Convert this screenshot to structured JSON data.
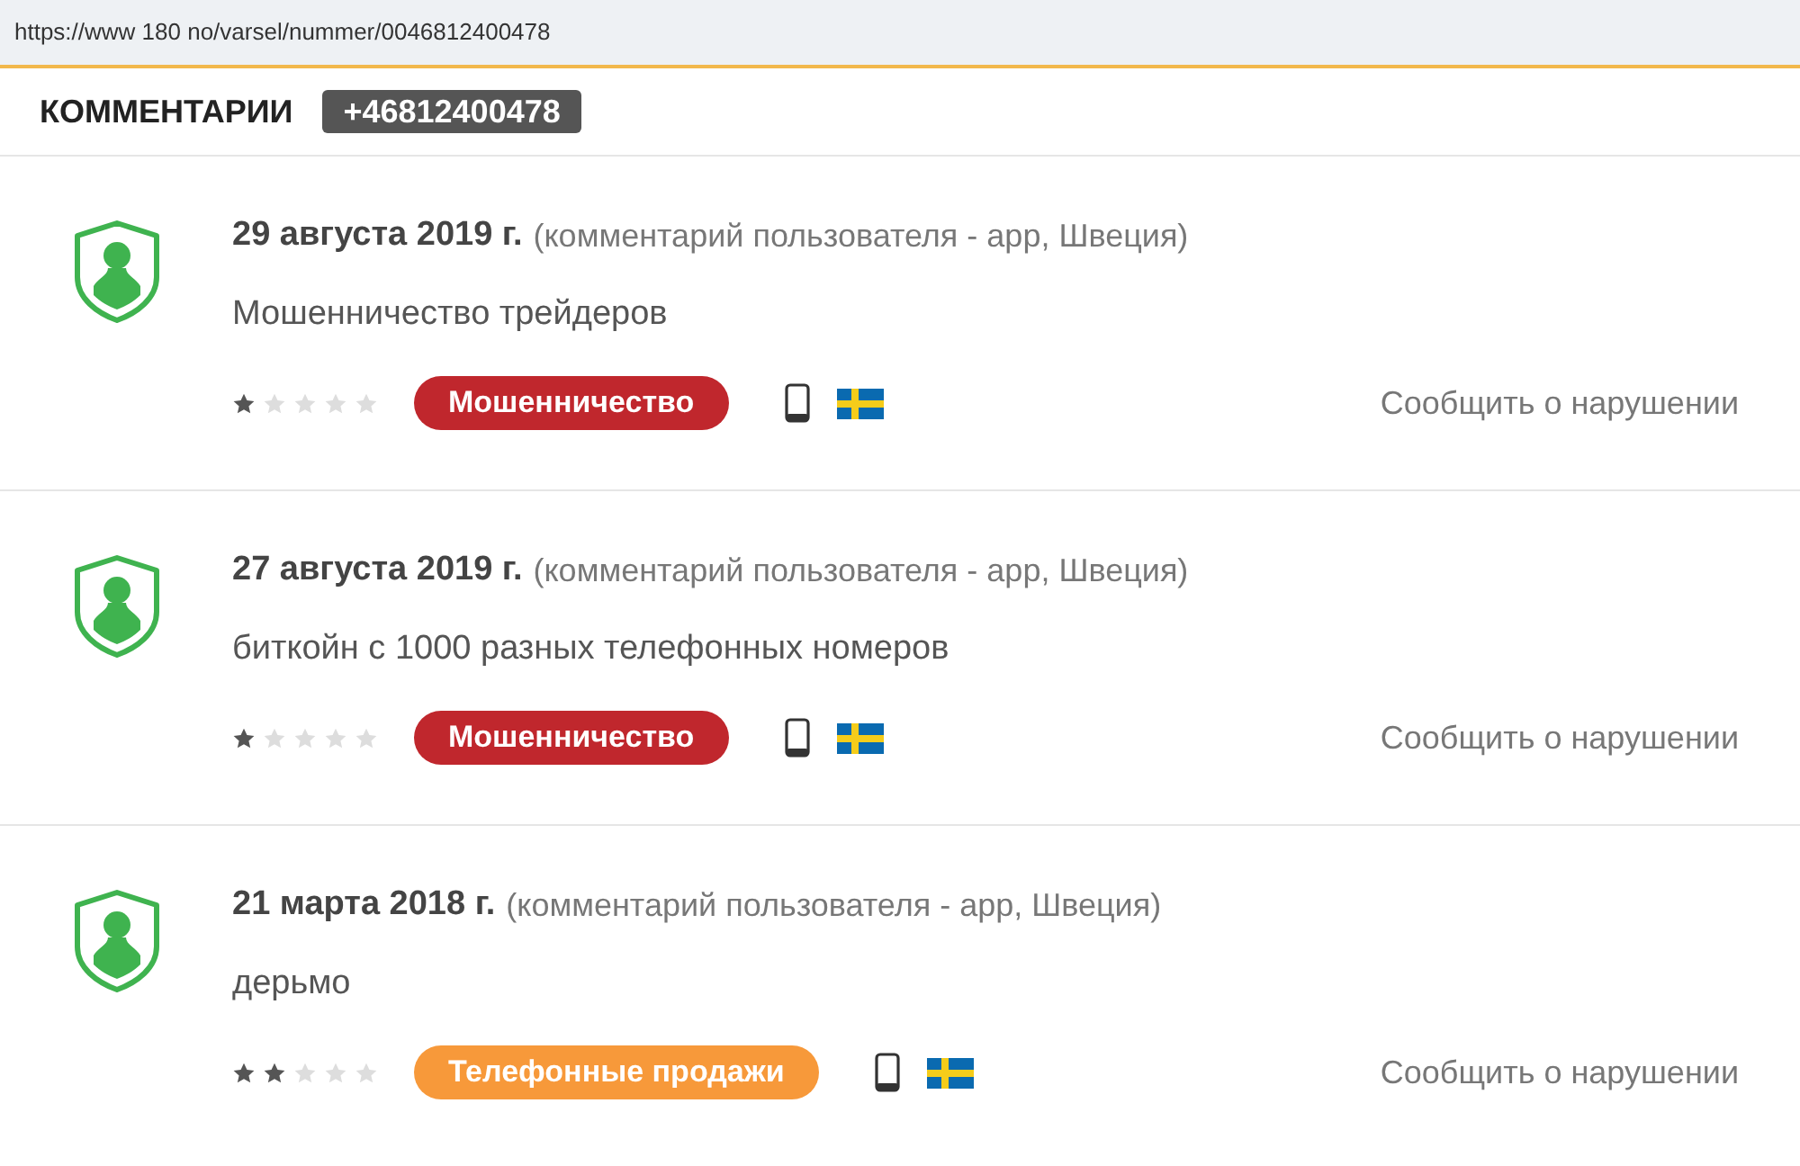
{
  "address_bar": {
    "url": "https://www 180 no/varsel/nummer/0046812400478"
  },
  "header": {
    "title": "КОММЕНТАРИИ",
    "phone": "+46812400478"
  },
  "comments": [
    {
      "date": "29 августа 2019 г.",
      "source": "(комментарий пользователя - app, Швеция)",
      "text": "Мошенничество трейдеров",
      "stars": 1,
      "tag": {
        "label": "Мошенничество",
        "color": "#c0272d"
      },
      "report": "Сообщить о нарушении"
    },
    {
      "date": "27 августа 2019 г.",
      "source": "(комментарий пользователя - app, Швеция)",
      "text": "биткойн с 1000 разных телефонных номеров",
      "stars": 1,
      "tag": {
        "label": "Мошенничество",
        "color": "#c0272d"
      },
      "report": "Сообщить о нарушении"
    },
    {
      "date": "21 марта 2018 г.",
      "source": "(комментарий пользователя - app, Швеция)",
      "text": "дерьмо",
      "stars": 2,
      "tag": {
        "label": "Телефонные продажи",
        "color": "#f7993a"
      },
      "report": "Сообщить о нарушении"
    }
  ]
}
